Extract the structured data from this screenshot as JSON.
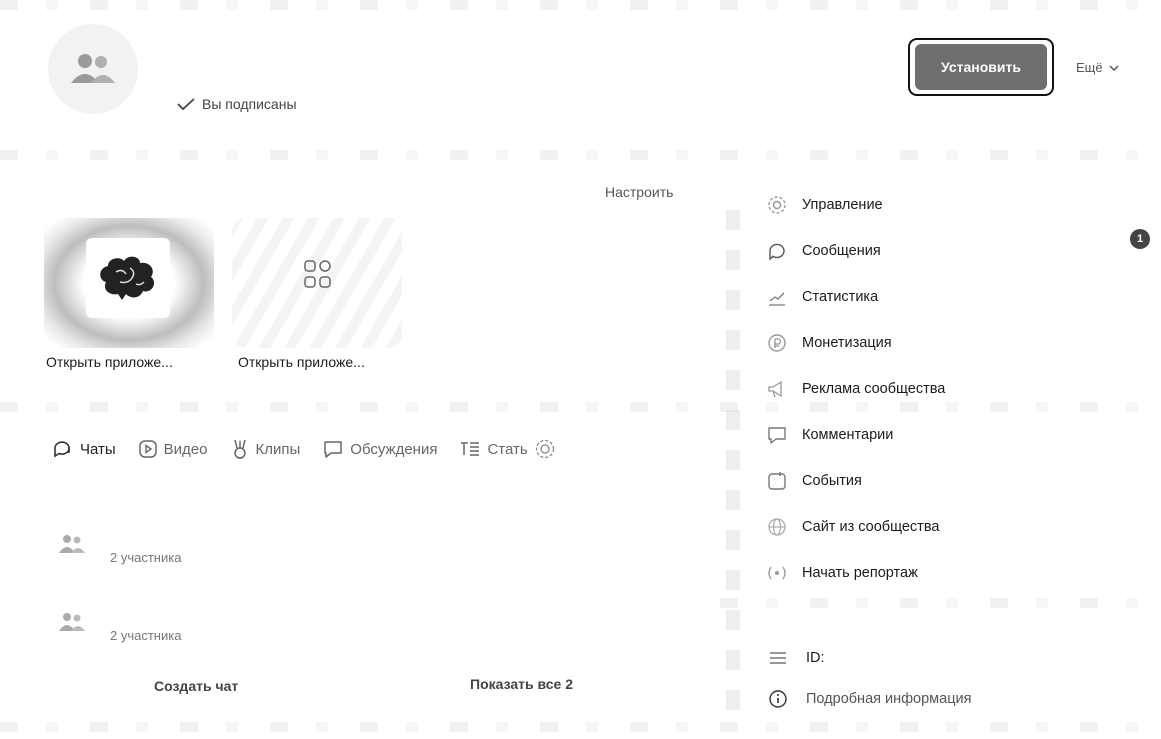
{
  "header": {
    "subscribed_label": "Вы подписаны",
    "install_label": "Установить",
    "more_label": "Ещё"
  },
  "apps": {
    "configure_label": "Настроить",
    "items": [
      {
        "label": "Открыть приложе...",
        "icon": "brain-icon"
      },
      {
        "label": "Открыть приложе...",
        "icon": "apps-grid-icon"
      }
    ]
  },
  "tabs": [
    {
      "label": "Чаты",
      "icon": "chat-icon",
      "active": true
    },
    {
      "label": "Видео",
      "icon": "video-icon"
    },
    {
      "label": "Клипы",
      "icon": "clips-icon"
    },
    {
      "label": "Обсуждения",
      "icon": "discussion-icon"
    },
    {
      "label": "Стать",
      "icon": "article-icon"
    }
  ],
  "chats": [
    {
      "members": "2 участника"
    },
    {
      "members": "2 участника"
    }
  ],
  "footer": {
    "create_chat": "Создать чат",
    "show_all": "Показать все 2"
  },
  "menu": [
    {
      "label": "Управление",
      "icon": "gear-icon"
    },
    {
      "label": "Сообщения",
      "icon": "message-icon",
      "badge": "1"
    },
    {
      "label": "Статистика",
      "icon": "stats-icon"
    },
    {
      "label": "Монетизация",
      "icon": "money-icon"
    },
    {
      "label": "Реклама сообщества",
      "icon": "megaphone-icon"
    },
    {
      "label": "Комментарии",
      "icon": "comment-icon"
    },
    {
      "label": "События",
      "icon": "events-icon"
    },
    {
      "label": "Сайт из сообщества",
      "icon": "globe-icon"
    },
    {
      "label": "Начать репортаж",
      "icon": "broadcast-icon"
    }
  ],
  "info": {
    "id_label": "ID:",
    "details_label": "Подробная информация"
  }
}
